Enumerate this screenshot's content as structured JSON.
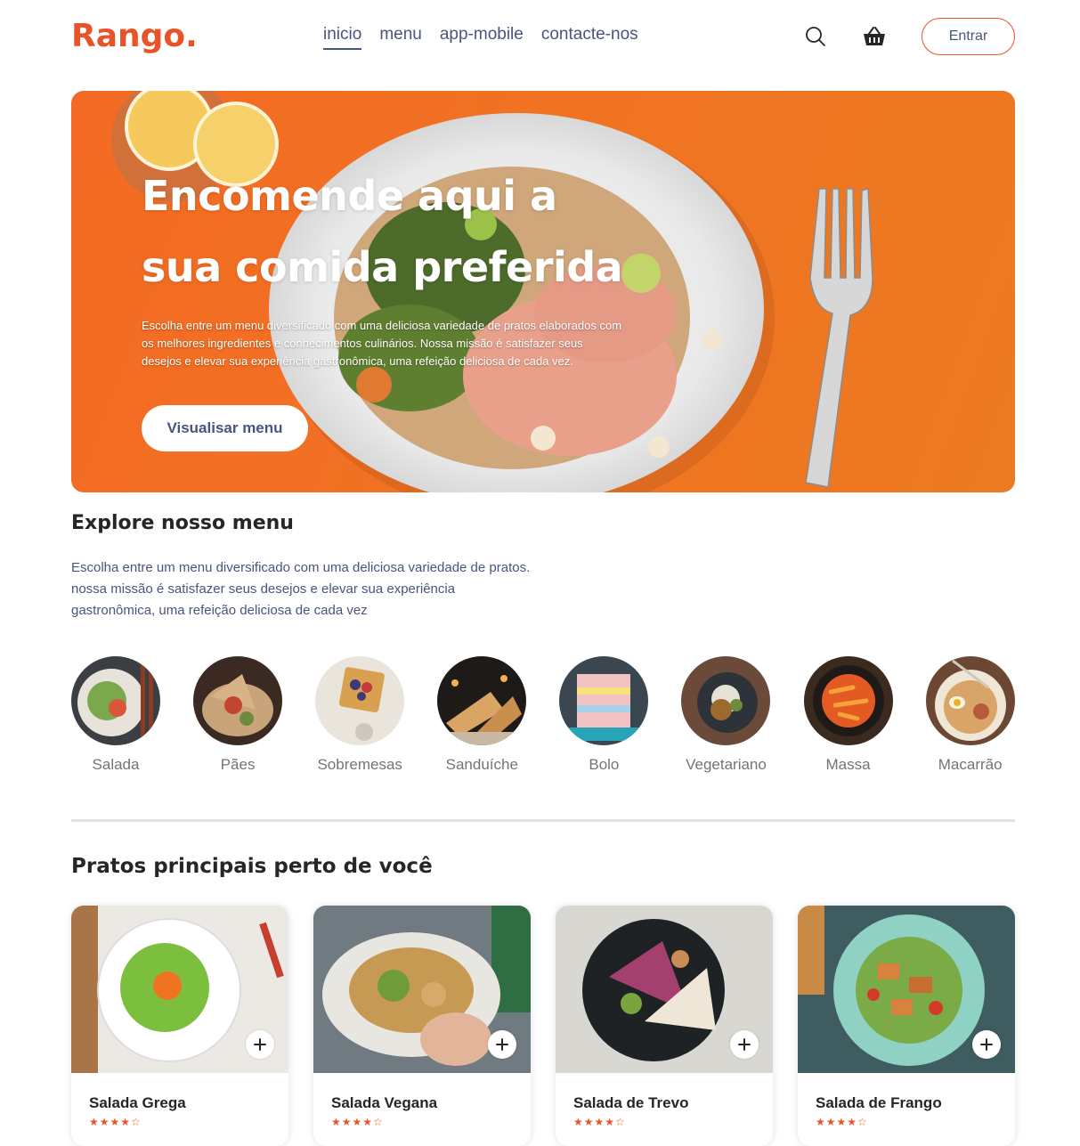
{
  "brand": {
    "logo": "Rango.",
    "accent": "#e8542a"
  },
  "nav": {
    "links": [
      "inicio",
      "menu",
      "app-mobile",
      "contacte-nos"
    ],
    "active": "inicio",
    "icons": [
      "search-icon",
      "basket-icon"
    ],
    "signin_label": "Entrar"
  },
  "hero": {
    "title": "Encomende aqui a sua comida preferida",
    "text": "Escolha entre um menu diversificado com uma deliciosa variedade de pratos elaborados com os melhores ingredientes e conhecimentos culinários. Nossa missão é satisfazer seus desejos e elevar sua experiência gastronômica, uma refeição deliciosa de cada vez.",
    "button_label": "Visualisar menu"
  },
  "explore": {
    "title": "Explore nosso menu",
    "text": "Escolha entre um menu diversificado com uma deliciosa variedade de pratos. nossa missão é satisfazer seus desejos e elevar sua experiência gastronômica, uma refeição deliciosa de cada vez",
    "categories": [
      "Salada",
      "Pães",
      "Sobremesas",
      "Sanduíche",
      "Bolo",
      "Vegetariano",
      "Massa",
      "Macarrão"
    ]
  },
  "dishes": {
    "title": "Pratos principais perto de você",
    "items": [
      {
        "name": "Salada Grega",
        "rating": 4
      },
      {
        "name": "Salada Vegana",
        "rating": 4
      },
      {
        "name": "Salada de Trevo",
        "rating": 4
      },
      {
        "name": "Salada de Frango",
        "rating": 4
      }
    ]
  }
}
